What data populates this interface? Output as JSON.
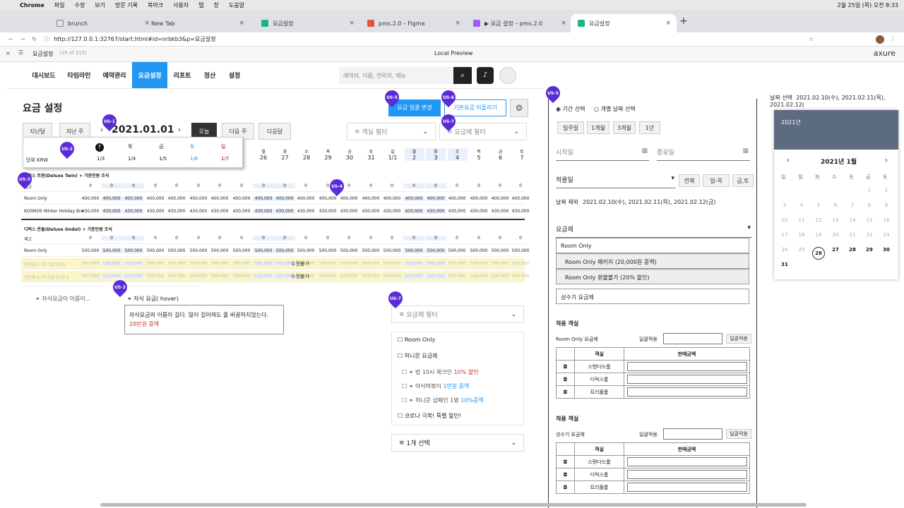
{
  "mac": {
    "app": "Chrome",
    "menus": [
      "파일",
      "수정",
      "보기",
      "방문 기록",
      "북마크",
      "사용자",
      "탭",
      "창",
      "도움말"
    ],
    "clock": "2월 25일 (목) 오전 8:33"
  },
  "tabs": [
    {
      "label": "brunch"
    },
    {
      "label": "New Tab"
    },
    {
      "label": "요금설정"
    },
    {
      "label": "pms.2.0 – Figma"
    },
    {
      "label": "▶ 요금 설정 – pms.2.0"
    },
    {
      "label": "요금설정"
    }
  ],
  "url": "http://127.0.0.1:32767/start.html#id=nrbkb3&p=요금설정",
  "axure": {
    "page": "요금설정",
    "count": "(19 of 115)",
    "preview": "Local Preview",
    "brand": "axure"
  },
  "nav": [
    "대시보드",
    "타임라인",
    "예약관리",
    "요금설정",
    "리포트",
    "정산",
    "설정"
  ],
  "search_placeholder": "예약자, 이름, 연락처, 메뉴",
  "page_title": "요금 설정",
  "btn_bulk": "요금 일괄 변경",
  "btn_reset": "기본요금 되돌리기",
  "prev_month": "지난달",
  "prev_week": "지난 주",
  "date": "2021.01.01",
  "today": "오늘",
  "next_week": "다음 주",
  "next_month": "다음달",
  "room_filter": "객실 필터",
  "rate_filter": "요금제 필터",
  "pins": [
    "US-1",
    "US-2",
    "US-3",
    "US-3",
    "US-4",
    "US-5",
    "US-5",
    "US-6",
    "US-7",
    "US-7"
  ],
  "popup": {
    "days": [
      "목",
      "금",
      "토",
      "일"
    ],
    "dates": [
      "1/3",
      "1/4",
      "1/5",
      "1/6",
      "1/7"
    ],
    "unit": "단위 KRW"
  },
  "header_days": [
    "토",
    "일",
    "월",
    "화",
    "수",
    "목",
    "금",
    "토",
    "일",
    "월",
    "화",
    "수",
    "목",
    "금",
    "토"
  ],
  "header_dates": [
    "26",
    "27",
    "28",
    "29",
    "30",
    "31",
    "1/1",
    "2",
    "3",
    "4",
    "5",
    "6",
    "7"
  ],
  "room1": "디럭스 트윈(Deluxe Twin) + 기준인원 조식",
  "room2": "디럭스 온돌(Deluxe Ondol) + 기준인원 조식",
  "row_stock": "재고",
  "row_roomonly": "Room Only",
  "row_kosmos": "KOSMOS Winter Holiday Bre",
  "v0": "0",
  "v400": "400,000",
  "v430": "430,000",
  "v500": "500,000",
  "linked1": "연동표시 (마크업 안내)",
  "linked2": "연동표시 (마크업 안내) e",
  "noedit": "수정불가",
  "child_rate": "자식요금이 이름이...",
  "child_hover": "자식 요금( hover)",
  "tooltip": "자식요금의 이름이 길다.  많이 길어져도 줄 바꿈하지않는다.",
  "tooltip_sub": "20만원 증액",
  "filter_list": {
    "title": "요금제 필터",
    "items": [
      "Room Only",
      "허니문 요금제",
      "밤 10시 체크인",
      "10% 할인",
      "야식떡볶이",
      "1만원 증액",
      "허니문 샴페인 1병",
      "10%증액",
      "코로나 극복! 특별 할인!"
    ],
    "selected": "1개 선택"
  },
  "side": {
    "period": "기간 선택",
    "single": "개별 날짜 선택",
    "quick": [
      "일주일",
      "1개월",
      "3개월",
      "1년"
    ],
    "start": "시작일",
    "end": "종료일",
    "apply_day": "적용일",
    "day_btns": [
      "전체",
      "일-목",
      "금,토"
    ],
    "exclude_label": "날짜 제외",
    "exclude": "2021.02.10(수), 2021.02.11(목), 2021.02.12(금)",
    "rate": "요금제",
    "rate_opts": [
      "Room Only",
      "Room Only 패키지 (20,000원 증액)",
      "Room Only 환불불가 (20% 할인)"
    ],
    "season": "성수기 요금제",
    "target": "적용 객실",
    "bulk_apply": "일괄적용",
    "col_room": "객실",
    "col_price": "판매금액",
    "rooms": [
      "스탠다드룸",
      "디럭스룸",
      "트리플룸"
    ],
    "ro_rate": "Room Only 요금제"
  },
  "cal": {
    "selected_label": "날짜 선택",
    "selected": "2021.02.10(수), 2021.02.11(목), 2021.02.12(",
    "year": "2021년",
    "month": "2021년 1월",
    "dow": [
      "일",
      "월",
      "화",
      "수",
      "목",
      "금",
      "토"
    ],
    "days": [
      "",
      "",
      "",
      "",
      "",
      "1",
      "2",
      "3",
      "4",
      "5",
      "6",
      "7",
      "8",
      "9",
      "10",
      "11",
      "12",
      "13",
      "14",
      "15",
      "16",
      "17",
      "18",
      "19",
      "20",
      "21",
      "22",
      "23",
      "24",
      "25",
      "26",
      "27",
      "28",
      "29",
      "30",
      "31"
    ]
  }
}
